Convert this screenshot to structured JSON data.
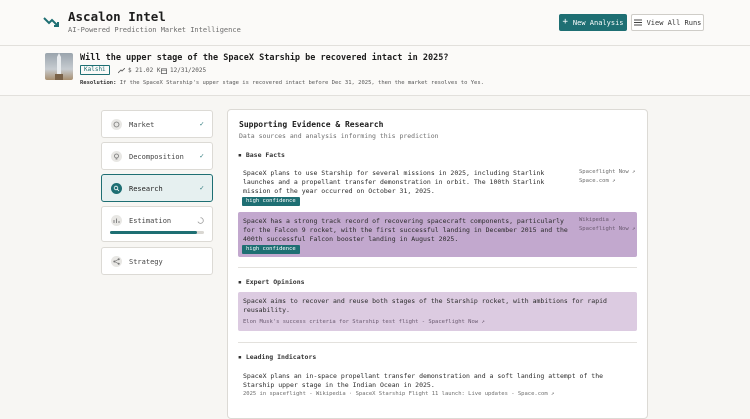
{
  "app": {
    "title": "Ascalon Intel",
    "subtitle": "AI-Powered Prediction Market Intelligence",
    "new_analysis": "New Analysis",
    "view_all_runs": "View All Runs",
    "accent": "#1e6f73"
  },
  "question": {
    "title": "Will the upper stage of the SpaceX Starship be recovered intact in 2025?",
    "platform": "Kalshi",
    "volume": "$ 21.02 K",
    "date": "12/31/2025",
    "resolution_label": "Resolution:",
    "resolution_text": "If the SpaceX Starship's upper stage is recovered intact before Dec 31, 2025, then the market resolves to Yes."
  },
  "steps": [
    {
      "label": "Market",
      "icon": "market-icon",
      "state": "done",
      "check": "✓"
    },
    {
      "label": "Decomposition",
      "icon": "bulb-icon",
      "state": "done",
      "check": "✓"
    },
    {
      "label": "Research",
      "icon": "search-icon",
      "state": "active",
      "check": "✓"
    },
    {
      "label": "Estimation",
      "icon": "chart-icon",
      "state": "running",
      "progress": 0.93
    },
    {
      "label": "Strategy",
      "icon": "share-icon",
      "state": "pending"
    }
  ],
  "panel": {
    "title": "Supporting Evidence & Research",
    "subtitle": "Data sources and analysis informing this prediction",
    "base_facts": {
      "heading": "Base Facts",
      "items": [
        {
          "text": "SpaceX plans to use Starship for several missions in 2025, including Starlink launches and a propellant transfer demonstration in orbit. The 100th Starlink mission of the year occurred on October 31, 2025.",
          "badge": "high confidence",
          "sources": [
            "Spaceflight Now",
            "Space.com"
          ]
        },
        {
          "text": "SpaceX has a strong track record of recovering spacecraft components, particularly for the Falcon 9 rocket, with the first successful landing in December 2015 and the 400th successful Falcon booster landing in August 2025.",
          "badge": "high confidence",
          "sources": [
            "Wikipedia",
            "Spaceflight Now"
          ]
        }
      ]
    },
    "expert_opinions": {
      "heading": "Expert Opinions",
      "items": [
        {
          "text": "SpaceX aims to recover and reuse both stages of the Starship rocket, with ambitions for rapid reusability.",
          "citation": "Elon Musk's success criteria for Starship test flight - Spaceflight Now"
        }
      ]
    },
    "leading_indicators": {
      "heading": "Leading Indicators",
      "items": [
        {
          "text": "SpaceX plans an in-space propellant transfer demonstration and a soft landing attempt of the Starship upper stage in the Indian Ocean in 2025.",
          "citation": "2025 in spaceflight - Wikipedia · SpaceX Starship Flight 11 launch: Live updates - Space.com"
        }
      ]
    }
  }
}
